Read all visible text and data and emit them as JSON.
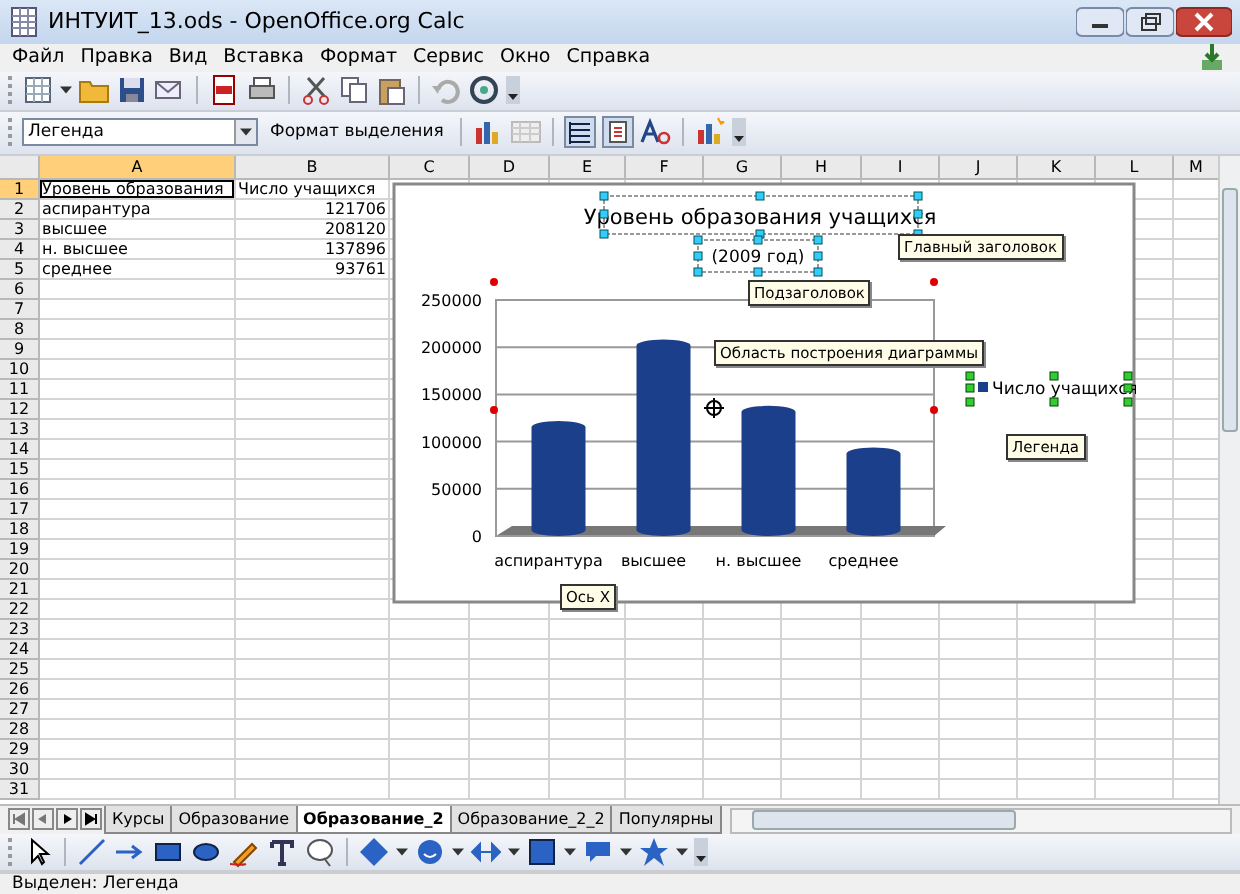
{
  "window": {
    "title": "ИНТУИТ_13.ods - OpenOffice.org Calc"
  },
  "menu": [
    "Файл",
    "Правка",
    "Вид",
    "Вставка",
    "Формат",
    "Сервис",
    "Окно",
    "Справка"
  ],
  "format_toolbar": {
    "name_box": "Легенда",
    "format_selection_button": "Формат выделения"
  },
  "sheet": {
    "columns": [
      {
        "label": "A",
        "selected": true
      },
      {
        "label": "B",
        "selected": false
      },
      {
        "label": "C",
        "selected": false
      },
      {
        "label": "D",
        "selected": false
      },
      {
        "label": "E",
        "selected": false
      },
      {
        "label": "F",
        "selected": false
      },
      {
        "label": "G",
        "selected": false
      },
      {
        "label": "H",
        "selected": false
      },
      {
        "label": "I",
        "selected": false
      },
      {
        "label": "J",
        "selected": false
      },
      {
        "label": "K",
        "selected": false
      },
      {
        "label": "L",
        "selected": false
      },
      {
        "label": "M",
        "selected": false
      }
    ],
    "rows": [
      {
        "label": "1",
        "selected": true,
        "cells": [
          {
            "text": "Уровень образования",
            "kind": "text"
          },
          {
            "text": "Число учащихся",
            "kind": "text"
          }
        ]
      },
      {
        "label": "2",
        "selected": false,
        "cells": [
          {
            "text": "аспирантура",
            "kind": "text"
          },
          {
            "text": "121706",
            "kind": "number"
          }
        ]
      },
      {
        "label": "3",
        "selected": false,
        "cells": [
          {
            "text": "высшее",
            "kind": "text"
          },
          {
            "text": "208120",
            "kind": "number"
          }
        ]
      },
      {
        "label": "4",
        "selected": false,
        "cells": [
          {
            "text": "н. высшее",
            "kind": "text"
          },
          {
            "text": "137896",
            "kind": "number"
          }
        ]
      },
      {
        "label": "5",
        "selected": false,
        "cells": [
          {
            "text": "среднее",
            "kind": "text"
          },
          {
            "text": "93761",
            "kind": "number"
          }
        ]
      },
      {
        "label": "6",
        "selected": false
      },
      {
        "label": "7",
        "selected": false
      },
      {
        "label": "8",
        "selected": false
      },
      {
        "label": "9",
        "selected": false
      },
      {
        "label": "10",
        "selected": false
      },
      {
        "label": "11",
        "selected": false
      },
      {
        "label": "12",
        "selected": false
      },
      {
        "label": "13",
        "selected": false
      },
      {
        "label": "14",
        "selected": false
      },
      {
        "label": "15",
        "selected": false
      },
      {
        "label": "16",
        "selected": false
      },
      {
        "label": "17",
        "selected": false
      },
      {
        "label": "18",
        "selected": false
      },
      {
        "label": "19",
        "selected": false
      },
      {
        "label": "20",
        "selected": false
      },
      {
        "label": "21",
        "selected": false
      },
      {
        "label": "22",
        "selected": false
      },
      {
        "label": "23",
        "selected": false
      },
      {
        "label": "24",
        "selected": false
      },
      {
        "label": "25",
        "selected": false
      },
      {
        "label": "26",
        "selected": false
      },
      {
        "label": "27",
        "selected": false
      },
      {
        "label": "28",
        "selected": false
      },
      {
        "label": "29",
        "selected": false
      },
      {
        "label": "30",
        "selected": false
      },
      {
        "label": "31",
        "selected": false
      }
    ]
  },
  "chart": {
    "subtitle": "(2009 год)",
    "chart_data": {
      "type": "bar",
      "title": "Уровень образования учащихся",
      "categories": [
        "аспирантура",
        "высшее",
        "н. высшее",
        "среднее"
      ],
      "series": [
        {
          "name": "Число учащихся",
          "color": "#1c3f8c",
          "values": [
            121706,
            208120,
            137896,
            93761
          ]
        }
      ],
      "grid": true,
      "ylim": [
        0,
        250000
      ],
      "yticks": [
        0,
        50000,
        100000,
        150000,
        200000,
        250000
      ]
    },
    "tooltips": [
      "Главный заголовок",
      "Подзаголовок",
      "Область построения диаграммы",
      "Легенда",
      "Ось X"
    ]
  },
  "sheet_tabs": [
    {
      "label": "Курсы",
      "selected": false
    },
    {
      "label": "Образование",
      "selected": false
    },
    {
      "label": "Образование_2",
      "selected": true
    },
    {
      "label": "Образование_2_2",
      "selected": false
    },
    {
      "label": "Популярны",
      "selected": false
    }
  ],
  "status_bar": "Выделен: Легенда"
}
